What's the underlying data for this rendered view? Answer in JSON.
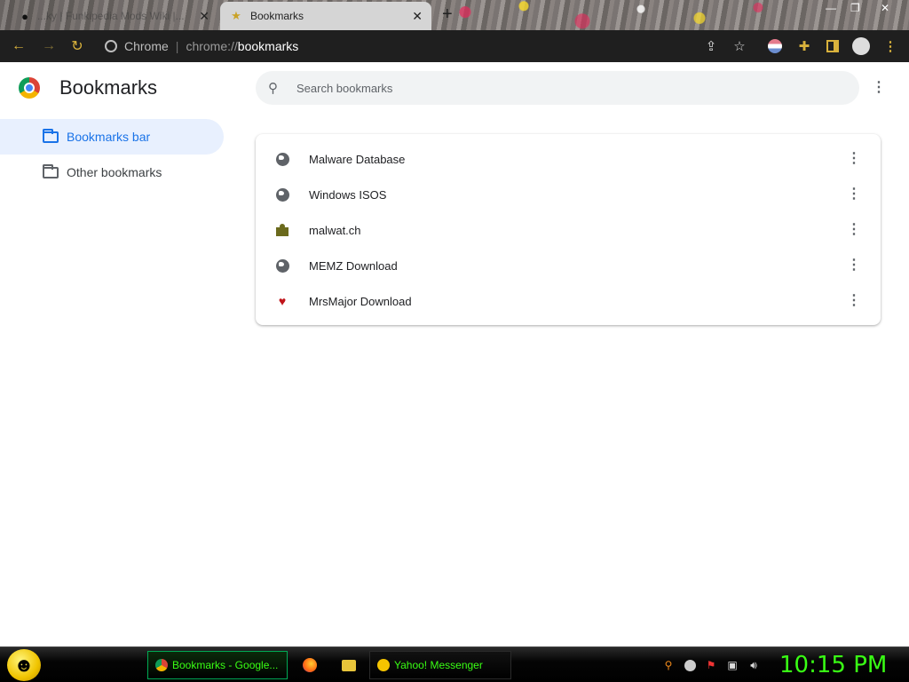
{
  "browser": {
    "tabs": [
      {
        "title": "...ky | Funkipedia Mods Wiki |...",
        "active": false
      },
      {
        "title": "Bookmarks",
        "active": true
      }
    ],
    "omnibox": {
      "site_label": "Chrome",
      "url_prefix": "chrome://",
      "url_path": "bookmarks"
    }
  },
  "page": {
    "title": "Bookmarks",
    "search_placeholder": "Search bookmarks",
    "sidebar": [
      {
        "label": "Bookmarks bar",
        "selected": true
      },
      {
        "label": "Other bookmarks",
        "selected": false
      }
    ],
    "bookmarks": [
      {
        "title": "Malware Database",
        "icon": "globe-icon"
      },
      {
        "title": "Windows ISOS",
        "icon": "globe-icon"
      },
      {
        "title": "malwat.ch",
        "icon": "malwatch-favicon"
      },
      {
        "title": "MEMZ Download",
        "icon": "globe-icon"
      },
      {
        "title": "MrsMajor Download",
        "icon": "heart-icon"
      }
    ]
  },
  "taskbar": {
    "windows": [
      {
        "title": "Bookmarks - Google...",
        "active": true
      },
      {
        "title": "Yahoo! Messenger",
        "active": false
      }
    ],
    "clock": "10:15 PM"
  },
  "colors": {
    "toolbar_bg": "#1f1f1f",
    "toolbar_icon": "#d9b23c",
    "selection_blue": "#1a73e8",
    "selection_bg": "#e8f0fe",
    "taskbar_text": "#39ff14"
  }
}
